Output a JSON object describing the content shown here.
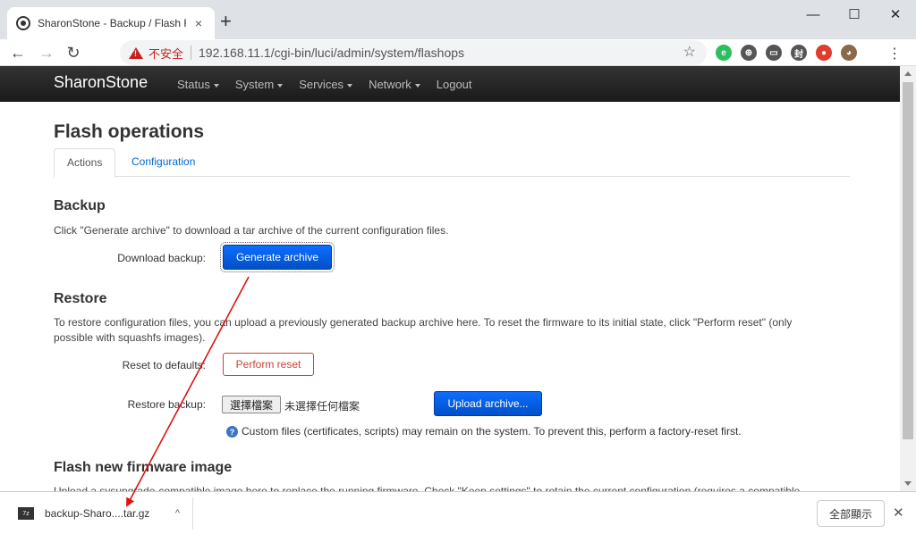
{
  "browser": {
    "tab_title": "SharonStone - Backup / Flash F",
    "tab_close": "×",
    "new_tab": "+",
    "window_controls": {
      "minimize": "—",
      "maximize": "☐",
      "close": "✕"
    },
    "nav": {
      "back": "←",
      "forward": "→",
      "reload": "↻"
    },
    "security_label": "不安全",
    "url": "192.168.11.1/cgi-bin/luci/admin/system/flashops",
    "bookmark": "☆",
    "extensions": [
      {
        "label": "e",
        "color": "#2dbe60"
      },
      {
        "label": "⊕",
        "color": "#555555"
      },
      {
        "label": "▭",
        "color": "#555555"
      },
      {
        "label": "封",
        "color": "#555555"
      },
      {
        "label": "●",
        "color": "#e03c31"
      },
      {
        "label": "◕",
        "color": "#8a6a4a"
      }
    ],
    "menu": "⋮"
  },
  "luci": {
    "brand": "SharonStone",
    "menu": [
      "Status",
      "System",
      "Services",
      "Network",
      "Logout"
    ]
  },
  "page": {
    "title": "Flash operations",
    "tabs": [
      {
        "label": "Actions",
        "active": true
      },
      {
        "label": "Configuration",
        "active": false
      }
    ],
    "backup": {
      "heading": "Backup",
      "description": "Click \"Generate archive\" to download a tar archive of the current configuration files.",
      "download_label": "Download backup:",
      "generate_button": "Generate archive"
    },
    "restore": {
      "heading": "Restore",
      "description": "To restore configuration files, you can upload a previously generated backup archive here. To reset the firmware to its initial state, click \"Perform reset\" (only possible with squashfs images).",
      "reset_label": "Reset to defaults:",
      "reset_button": "Perform reset",
      "restore_label": "Restore backup:",
      "choose_file": "選擇檔案",
      "no_file": "未選擇任何檔案",
      "upload_button": "Upload archive...",
      "help_icon": "?",
      "help_text": "Custom files (certificates, scripts) may remain on the system. To prevent this, perform a factory-reset first."
    },
    "flash": {
      "heading": "Flash new firmware image",
      "description": "Upload a sysupgrade-compatible image here to replace the running firmware. Check \"Keep settings\" to retain the current configuration (requires a compatible"
    }
  },
  "downloads": {
    "icon_label": "7z",
    "file_name": "backup-Sharo....tar.gz",
    "chevron": "^",
    "show_all": "全部顯示",
    "close": "✕"
  },
  "colors": {
    "primary": "#0050c8",
    "danger": "#cc4433",
    "annotation": "#e01010"
  }
}
